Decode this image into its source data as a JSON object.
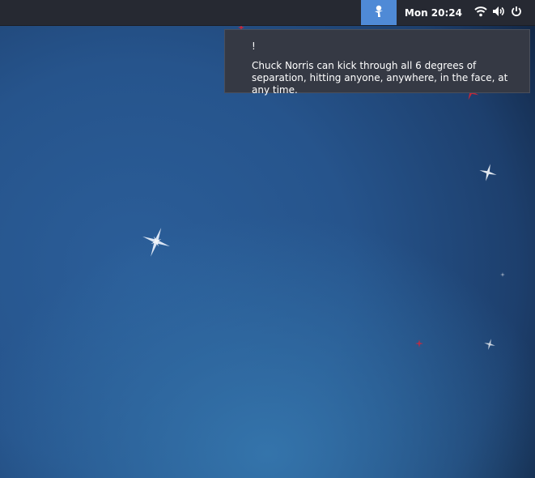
{
  "panel": {
    "clock": "Mon 20:24",
    "icons": [
      "notification-indicator-icon",
      "wifi-icon",
      "volume-icon",
      "power-icon"
    ]
  },
  "notification": {
    "title": "!",
    "body": "Chuck Norris can kick through all 6 degrees of separation, hitting anyone, anywhere, in the face, at any time."
  },
  "colors": {
    "panel_bg": "#262932",
    "indicator_bg": "#4f8ad6",
    "notification_bg": "#353944",
    "wallpaper_center": "#2b5e99",
    "wallpaper_edge": "#03060c"
  }
}
